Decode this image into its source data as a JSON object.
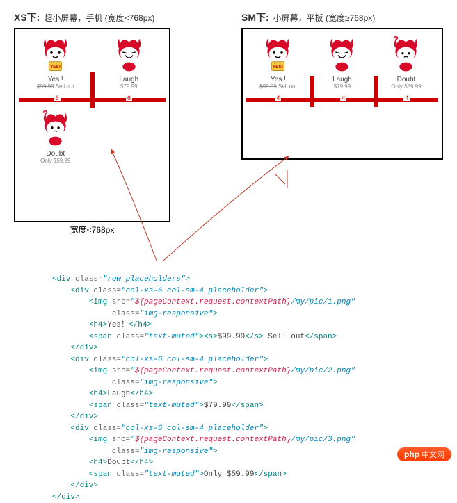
{
  "xs": {
    "title": "XS下:",
    "desc": "超小屏幕，手机 (宽度<768px)",
    "caption": "宽度<768px",
    "colBadge": "6"
  },
  "sm": {
    "title": "SM下:",
    "desc": "小屏幕，平板 (宽度≥768px)",
    "colBadge": "4"
  },
  "cards": {
    "yes": {
      "name": "Yes !",
      "priceStrike": "$99.99",
      "tail": "Sell out"
    },
    "laugh": {
      "name": "Laugh",
      "price": "$79.99"
    },
    "doubt": {
      "name": "Doubt",
      "price": "Only $59.99"
    }
  },
  "code": {
    "l1a": "<div",
    "l1b": "class=",
    "l1c": "\"row placeholders\"",
    "l1d": ">",
    "l2a": "<div",
    "l2b": "class=",
    "l2c": "\"col-xs-6 col-sm-4 placeholder\"",
    "l2d": ">",
    "l3a": "<img",
    "l3b": "src=",
    "l3c": "\"",
    "l3d": "${pageContext.request.contextPath}",
    "l3e": "/my/pic/1.png",
    "l3f": "\"",
    "l4b": "class=",
    "l4c": "\"img-responsive\"",
    "l4d": ">",
    "l5a": "<h4>",
    "l5b": "Yes！",
    "l5c": "</h4>",
    "l6a": "<span",
    "l6b": "class=",
    "l6c": "\"text-muted\"",
    "l6d": "><s>",
    "l6e": "$99.99",
    "l6f": "</s>",
    "l6g": " Sell out",
    "l6h": "</span>",
    "l7": "</div>",
    "l8a": "<div",
    "l8b": "class=",
    "l8c": "\"col-xs-6 col-sm-4 placeholder\"",
    "l8d": ">",
    "l9a": "<img",
    "l9b": "src=",
    "l9c": "\"",
    "l9d": "${pageContext.request.contextPath}",
    "l9e": "/my/pic/2.png",
    "l9f": "\"",
    "l10b": "class=",
    "l10c": "\"img-responsive\"",
    "l10d": ">",
    "l11a": "<h4>",
    "l11b": "Laugh",
    "l11c": "</h4>",
    "l12a": "<span",
    "l12b": "class=",
    "l12c": "\"text-muted\"",
    "l12d": ">",
    "l12e": "$79.99",
    "l12f": "</span>",
    "l13": "</div>",
    "l14a": "<div",
    "l14b": "class=",
    "l14c": "\"col-xs-6 col-sm-4 placeholder\"",
    "l14d": ">",
    "l15a": "<img",
    "l15b": "src=",
    "l15c": "\"",
    "l15d": "${pageContext.request.contextPath}",
    "l15e": "/my/pic/3.png",
    "l15f": "\"",
    "l16b": "class=",
    "l16c": "\"img-responsive\"",
    "l16d": ">",
    "l17a": "<h4>",
    "l17b": "Doubt",
    "l17c": "</h4>",
    "l18a": "<span",
    "l18b": "class=",
    "l18c": "\"text-muted\"",
    "l18d": ">",
    "l18e": "Only $59.99",
    "l18f": "</span>",
    "l19": "</div>",
    "l20": "</div>"
  },
  "watermark": {
    "brand": "php",
    "text": "中文网"
  }
}
